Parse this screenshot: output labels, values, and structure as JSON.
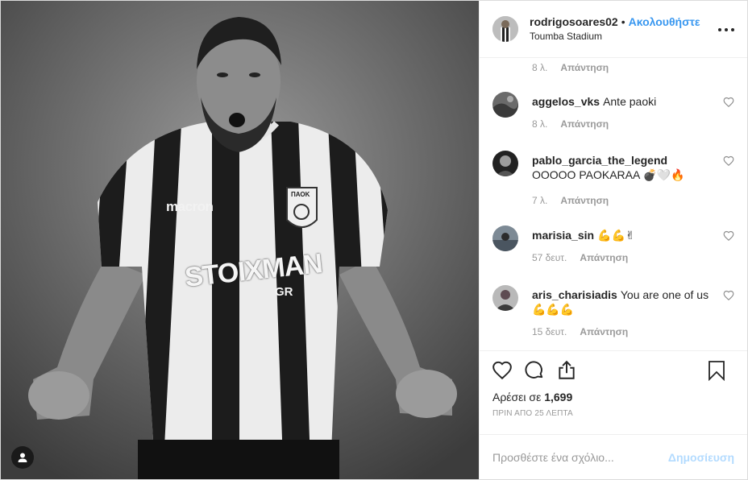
{
  "post": {
    "username": "rodrigosoares02",
    "separator": "•",
    "follow_label": "Ακολουθήστε",
    "location": "Toumba Stadium"
  },
  "photo": {
    "jersey_brand": "macron",
    "jersey_sponsor": "STOIXMAN",
    "jersey_sponsor_suffix": "GR",
    "badge_text": "ΠΑΟΚ"
  },
  "top_meta": {
    "time": "8 λ.",
    "reply": "Απάντηση"
  },
  "comments": [
    {
      "user": "aggelos_vks",
      "text": "Ante paoki",
      "time": "8 λ.",
      "reply": "Απάντηση"
    },
    {
      "user": "pablo_garcia_the_legend",
      "text": "OOOOO PAOKARAA 💣🤍🔥",
      "time": "7 λ.",
      "reply": "Απάντηση"
    },
    {
      "user": "marisia_sin",
      "text": "💪💪✌",
      "time": "57 δευτ.",
      "reply": "Απάντηση"
    },
    {
      "user": "aris_charisiadis",
      "text": "You are one of us 💪💪💪",
      "time": "15 δευτ.",
      "reply": "Απάντηση"
    }
  ],
  "likes": {
    "prefix": "Αρέσει σε",
    "count": "1,699"
  },
  "timestamp": "ΠΡΙΝ ΑΠΟ 25 ΛΕΠΤΑ",
  "add_comment": {
    "placeholder": "Προσθέστε ένα σχόλιο...",
    "post_label": "Δημοσίευση"
  },
  "icons": [
    "user-tag-icon",
    "more-options-icon",
    "heart-icon",
    "comment-icon",
    "share-icon",
    "bookmark-icon"
  ],
  "colors": {
    "accent": "#3897f0",
    "post_disabled": "#b3dbff",
    "muted": "#999999",
    "text": "#262626"
  }
}
